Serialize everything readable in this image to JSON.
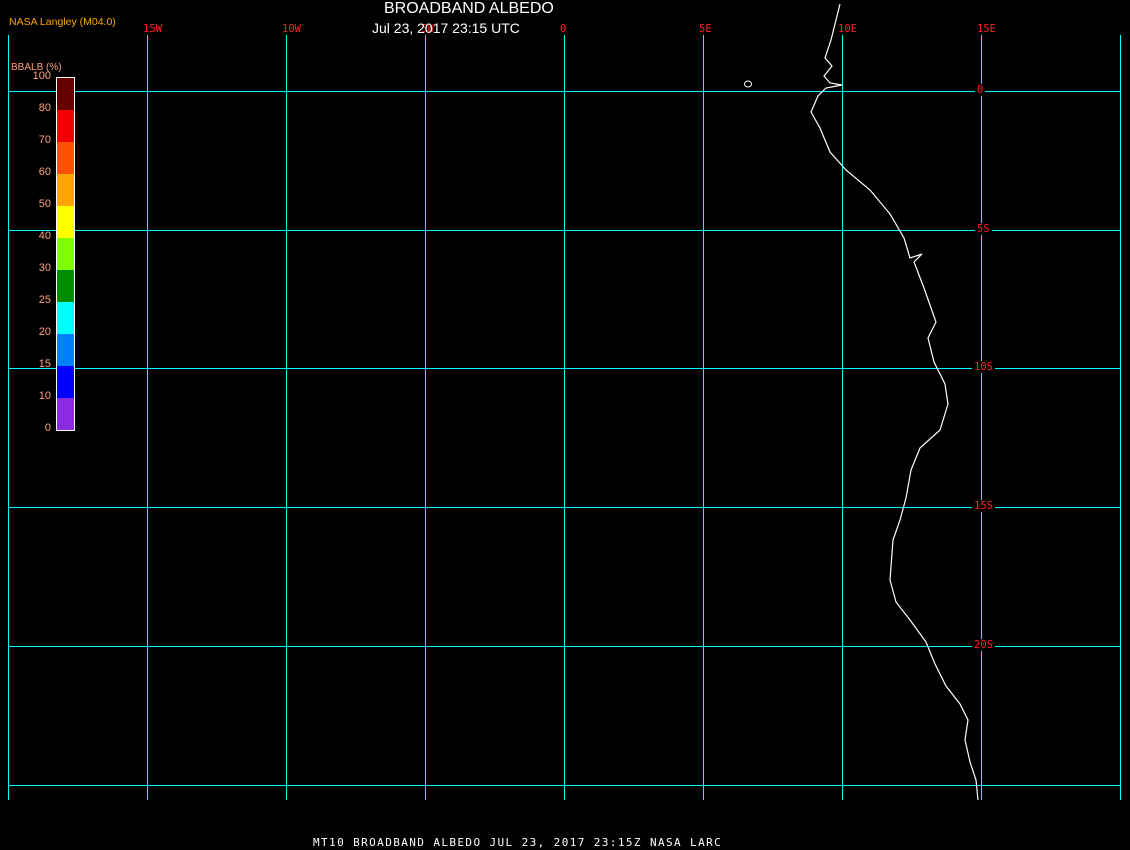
{
  "header": {
    "title": "BROADBAND ALBEDO",
    "subtitle": "Jul 23, 2017 23:15 UTC",
    "credit": "NASA Langley (M04.0)"
  },
  "footer": "MT10  BROADBAND ALBEDO   JUL 23, 2017 23:15Z   NASA LARC",
  "grid": {
    "color": "#00ffff",
    "longitudes": [
      "15W",
      "10W",
      "5W",
      "0",
      "5E",
      "10E",
      "15E"
    ],
    "latitudes": [
      "0",
      "5S",
      "10S",
      "15S",
      "20S"
    ]
  },
  "coastline_color": "#ffffff",
  "colorbar": {
    "title": "BBALB (%)",
    "labels": [
      "100",
      "80",
      "70",
      "60",
      "50",
      "40",
      "30",
      "25",
      "20",
      "15",
      "10",
      "0"
    ],
    "colors": [
      "#640000",
      "#f00000",
      "#ff5000",
      "#ffa500",
      "#ffff00",
      "#80ff00",
      "#008c00",
      "#00ffff",
      "#0080ff",
      "#0000ff",
      "#8a2be2"
    ]
  }
}
